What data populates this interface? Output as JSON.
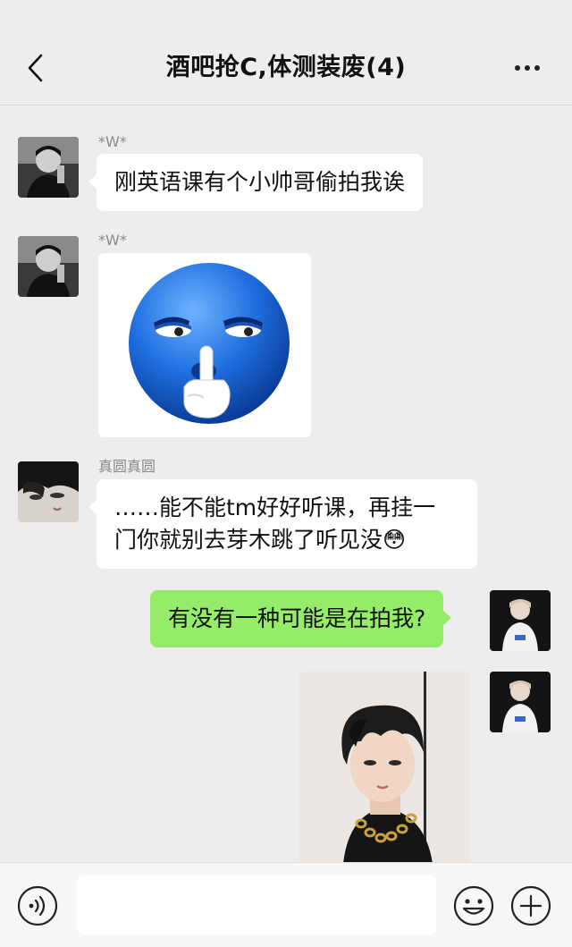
{
  "header": {
    "title": "酒吧抢C,体测装废(4)",
    "back_icon": "chevron-left-icon",
    "more_icon": "more-dots-icon"
  },
  "messages": [
    {
      "sender": "*W*",
      "type": "text",
      "side": "left",
      "text": "刚英语课有个小帅哥偷拍我诶"
    },
    {
      "sender": "*W*",
      "type": "image",
      "side": "left",
      "image": "blue-shush-emoji-sticker"
    },
    {
      "sender": "真圆真圆",
      "type": "text",
      "side": "left",
      "line1": "……能不能tm好好听课，再挂一",
      "line2": "门你就别去芽木跳了听见没",
      "emoji": "😳"
    },
    {
      "sender": "me",
      "type": "text",
      "side": "right",
      "text": "有没有一种可能是在拍我?"
    },
    {
      "sender": "me",
      "type": "image",
      "side": "right",
      "image": "selfie-photo"
    }
  ],
  "input_bar": {
    "voice_icon": "voice-icon",
    "emoji_icon": "emoji-icon",
    "plus_icon": "plus-circle-icon",
    "placeholder": ""
  },
  "colors": {
    "background": "#ededed",
    "bubble_self": "#95ec69",
    "bubble_other": "#ffffff"
  }
}
